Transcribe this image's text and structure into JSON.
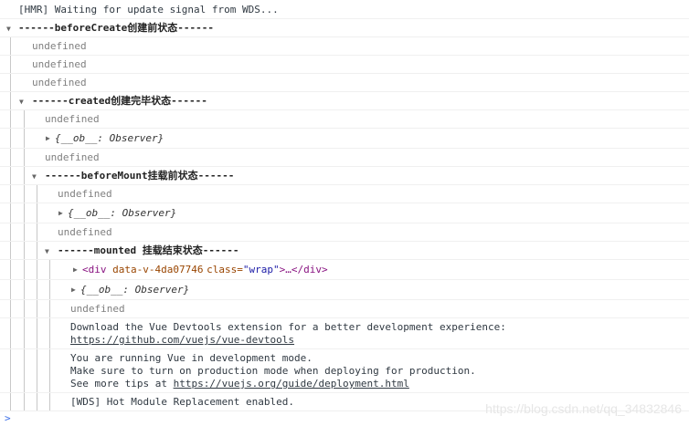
{
  "hmr_message": "[HMR] Waiting for update signal from WDS...",
  "undefined_label": "undefined",
  "observer_label": "{__ob__: Observer}",
  "groups": {
    "before_create": "------beforeCreate创建前状态------",
    "created": "------created创建完毕状态------",
    "before_mount": "------beforeMount挂载前状态------",
    "mounted": "------mounted 挂载结束状态------"
  },
  "element_preview": {
    "open_tag": "<div",
    "attr_name": "data-v-4da07746",
    "class_attr": "class=",
    "class_value": "\"wrap\"",
    "close": ">…</div>"
  },
  "devtools": {
    "line1": "Download the Vue Devtools extension for a better development experience:",
    "link": "https://github.com/vuejs/vue-devtools"
  },
  "dev_mode": {
    "line1": "You are running Vue in development mode.",
    "line2": "Make sure to turn on production mode when deploying for production.",
    "line3_prefix": "See more tips at ",
    "link": "https://vuejs.org/guide/deployment.html"
  },
  "wds_message": "[WDS] Hot Module Replacement enabled.",
  "prompt_symbol": ">",
  "watermark": "https://blog.csdn.net/qq_34832846"
}
